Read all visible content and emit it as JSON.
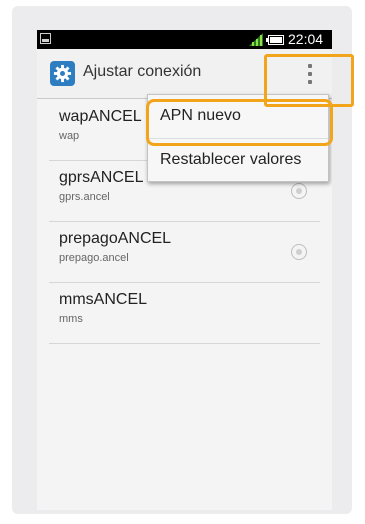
{
  "statusbar": {
    "time": "22:04"
  },
  "actionbar": {
    "title": "Ajustar conexión",
    "icon": "settings-gear-icon",
    "overflow_icon": "overflow-menu-icon"
  },
  "apn_list": [
    {
      "name": "wapANCEL",
      "apn": "wap"
    },
    {
      "name": "gprsANCEL",
      "apn": "gprs.ancel"
    },
    {
      "name": "prepagoANCEL",
      "apn": "prepago.ancel"
    },
    {
      "name": "mmsANCEL",
      "apn": "mms"
    }
  ],
  "overflow_menu": [
    {
      "label": "APN nuevo"
    },
    {
      "label": "Restablecer valores"
    }
  ],
  "colors": {
    "highlight": "#f2a51a",
    "app_icon": "#2e7dc1"
  }
}
